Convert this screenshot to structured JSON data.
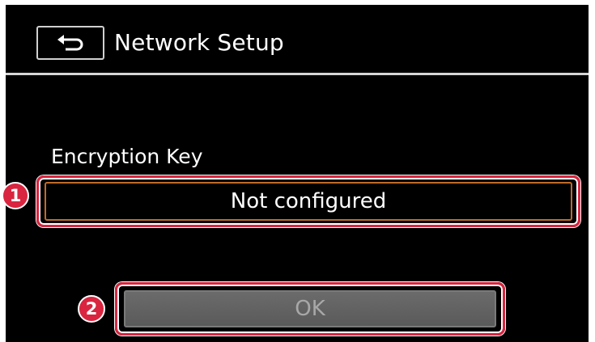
{
  "header": {
    "back_icon": "return-arrow-icon",
    "title": "Network Setup"
  },
  "encryption": {
    "label": "Encryption Key",
    "value": "Not configured"
  },
  "actions": {
    "ok_label": "OK",
    "ok_enabled": false
  },
  "callouts": {
    "first": "1",
    "second": "2"
  },
  "colors": {
    "screen_background": "#000000",
    "highlight": "#d9253f",
    "field_border": "#c06a2a",
    "ok_disabled_fill": "#6b6b6b"
  }
}
